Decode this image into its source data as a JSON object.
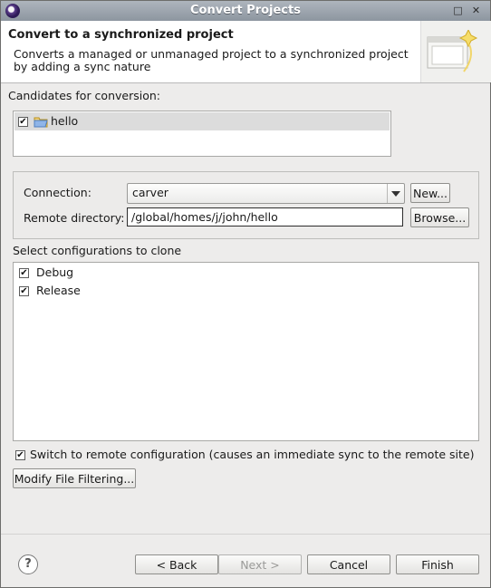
{
  "window": {
    "title": "Convert Projects",
    "minimize_glyph": "□",
    "close_glyph": "✕"
  },
  "header": {
    "title": "Convert to a synchronized project",
    "description": "Converts a managed or unmanaged project to a synchronized project by adding a sync nature",
    "wizard_icon": "sync-wizard-icon"
  },
  "candidates": {
    "label": "Candidates for conversion:",
    "items": [
      {
        "label": "hello",
        "checked": true,
        "icon": "folder-icon"
      }
    ]
  },
  "connection": {
    "label": "Connection:",
    "value": "carver",
    "new_button": "New...",
    "remote_dir_label": "Remote directory:",
    "remote_dir_value": "/global/homes/j/john/hello",
    "browse_button": "Browse..."
  },
  "configs": {
    "label": "Select configurations to clone",
    "items": [
      {
        "label": "Debug",
        "checked": true
      },
      {
        "label": "Release",
        "checked": true
      }
    ]
  },
  "switch_remote": {
    "label": "Switch to remote configuration (causes an immediate sync to the remote site)",
    "checked": true
  },
  "modify_filtering_button": "Modify File Filtering...",
  "footer": {
    "help_glyph": "?",
    "back_button": "< Back",
    "next_button": "Next >",
    "cancel_button": "Cancel",
    "finish_button": "Finish"
  }
}
